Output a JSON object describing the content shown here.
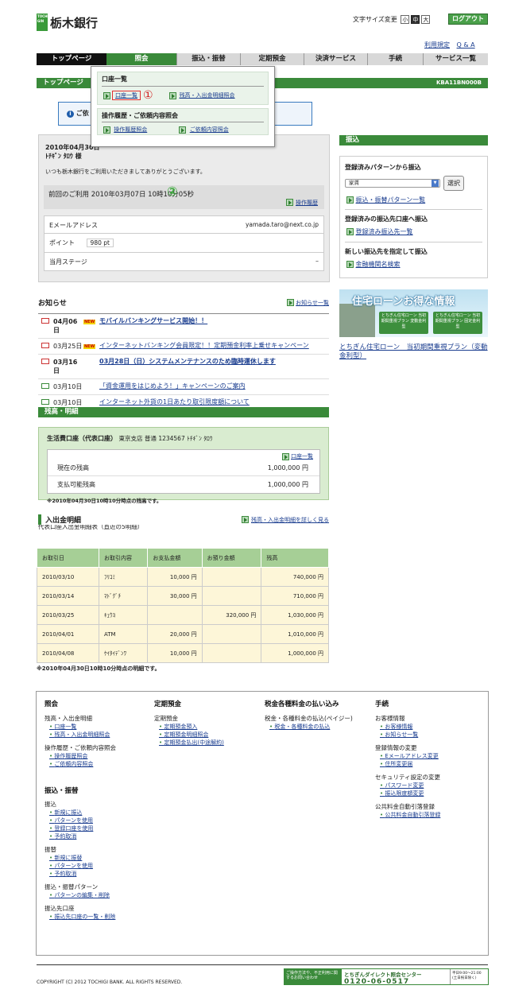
{
  "logo": {
    "badge": "TOCHI GIN",
    "name": "栃木銀行"
  },
  "fontsize": {
    "label": "文字サイズ変更",
    "small": "小",
    "mid": "中",
    "large": "大"
  },
  "logout": "ログアウト",
  "toplinks": [
    "利用規定",
    "Q & A"
  ],
  "nav": [
    "トップページ",
    "照会",
    "振込・振替",
    "定期預金",
    "決済サービス",
    "手続",
    "サービス一覧"
  ],
  "page": {
    "title": "トップページ",
    "code": "KBA11BN000B"
  },
  "dropdown": {
    "h1": "口座一覧",
    "i1a": "口座一覧",
    "i1b": "残高・入出金明細照会",
    "h2": "操作履歴・ご依頼内容照会",
    "i2a": "操作履歴照会",
    "i2b": "ご依頼内容照会",
    "m1": "①",
    "m2": "②"
  },
  "notice": "ご依",
  "welcome": {
    "date": "2010年04月30日",
    "name": "ﾄﾁｷﾞﾝ ﾀﾛｳ 様",
    "msg": "いつも栃木銀行をご利用いただきましてありがとうございます。",
    "last": "前回のご利用 2010年03月07日 10時10分05秒",
    "hist": "操作履歴"
  },
  "profile": {
    "email_l": "Eメールアドレス",
    "email_v": "yamada.taro@next.co.jp",
    "pt_l": "ポイント",
    "pt_v": "980 pt",
    "st_l": "当月ステージ",
    "st_v": "–"
  },
  "transfer": {
    "title": "振込",
    "t1": "登録済みパターンから振込",
    "sel": "家賃",
    "btn": "選択",
    "l1": "振込・振替パターン一覧",
    "t2": "登録済みの振込先口座へ振込",
    "l2": "登録済み振込先一覧",
    "t3": "新しい振込先を指定して振込",
    "l3": "金融機関名検索"
  },
  "banner": {
    "title": "住宅ローンお得な情報",
    "b1": "とちぎん住宅ローン 当初期間重視プラン 変動金利型",
    "b2": "とちぎん住宅ローン 当初期間重視プラン 固定金利型",
    "link": "とちぎん住宅ローン　当初期間重視プラン（変動金利型）"
  },
  "news": {
    "title": "お知らせ",
    "all": "お知らせ一覧",
    "new": "NEW",
    "items": [
      {
        "date": "04月06日",
        "text": "モバイルバンキングサービス開始！！",
        "new": true,
        "bold": true
      },
      {
        "date": "03月25日",
        "text": "インターネットバンキング会員限定！！定期預金利率上乗せキャンペーン",
        "new": true,
        "bold": false
      },
      {
        "date": "03月16日",
        "text": "03月28日（日）システムメンテナンスのため臨時運休します",
        "new": false,
        "bold": true
      },
      {
        "date": "03月10日",
        "text": "「資金運用をはじめよう！」キャンペーンのご案内",
        "new": false,
        "bold": false
      },
      {
        "date": "03月10日",
        "text": "インターネット外貨の1日あたり取引限度額について",
        "new": false,
        "bold": false
      }
    ]
  },
  "balance": {
    "title": "残高・明細",
    "acct": "生活費口座（代表口座）",
    "acct2": "東京支店 普通 1234567 ﾄﾁｷﾞﾝ ﾀﾛｳ",
    "list": "口座一覧",
    "cur_l": "現在の残高",
    "cur_v": "1,000,000 円",
    "avl_l": "支払可能残高",
    "avl_v": "1,000,000 円",
    "note": "※2010年04月30日10時10分時点の残高です。"
  },
  "detail": {
    "title": "入出金明細",
    "link": "残高・入出金明細を詳しく見る",
    "sub": "代表口座入出金明細表（直近の5明細）",
    "cols": [
      "お取引日",
      "お取引内容",
      "お支払金額",
      "お預り金額",
      "残高"
    ],
    "rows": [
      [
        "2010/03/10",
        "ﾌﾘｺﾐ",
        "10,000 円",
        "",
        "740,000 円"
      ],
      [
        "2010/03/14",
        "ﾏﾄﾞｸﾞﾁ",
        "30,000 円",
        "",
        "710,000 円"
      ],
      [
        "2010/03/25",
        "ｷｭｳﾖ",
        "",
        "320,000 円",
        "1,030,000 円"
      ],
      [
        "2010/04/01",
        "ATM",
        "20,000 円",
        "",
        "1,010,000 円"
      ],
      [
        "2010/04/08",
        "ｹｲﾀｲﾃﾞﾝﾜ",
        "10,000 円",
        "",
        "1,000,000 円"
      ]
    ],
    "note": "※2010年04月30日10時10分時点の明細です。"
  },
  "footer": {
    "c1": {
      "h": "照会",
      "s1": "残高・入出金明細",
      "l1": [
        "口座一覧",
        "残高・入出金明細照会"
      ],
      "s2": "操作履歴・ご依頼内容照会",
      "l2": [
        "操作履歴照会",
        "ご依頼内容照会"
      ]
    },
    "c1b": {
      "h": "振込・振替",
      "s1": "振込",
      "l1": [
        "新規に振込",
        "パターンを使用",
        "登録口座を使用",
        "予約取消"
      ],
      "s2": "振替",
      "l2": [
        "新規に振替",
        "パターンを使用",
        "予約取消"
      ],
      "s3": "振込・振替パターン",
      "l3": [
        "パターンの編集・削除"
      ],
      "s4": "振込先口座",
      "l4": [
        "振込先口座の一覧・削除"
      ]
    },
    "c2": {
      "h": "定期預金",
      "s1": "定期預金",
      "l1": [
        "定期預金預入",
        "定期預金明細照会",
        "定期預金払出(中途解約)"
      ]
    },
    "c3": {
      "h": "税金各種料金の払い込み",
      "s1": "税金・各種料金の払込(ペイジー)",
      "l1": [
        "税金・各種料金の払込"
      ]
    },
    "c4": {
      "h": "手続",
      "s1": "お客様情報",
      "l1": [
        "お客様情報",
        "お知らせ一覧"
      ],
      "s2": "登録情報の変更",
      "l2": [
        "Eメールアドレス変更",
        "住所変更届"
      ],
      "s3": "セキュリティ設定の変更",
      "l3": [
        "パスワード変更",
        "振込限度額変更"
      ],
      "s4": "公共料金自動引落登録",
      "l4": [
        "公共料金自動引落登録"
      ]
    }
  },
  "copyright": "COPYRIGHT (C) 2012 TOCHIGI BANK. ALL RIGHTS RESERVED.",
  "contact": {
    "lead": "ご操作方法や、不正利用に関するお問い合わせ",
    "title": "とちぎんダイレクト照会センター",
    "tel": "0120-06-0517",
    "hours": "平日9:00～21:00 (土日祝日除く)"
  }
}
